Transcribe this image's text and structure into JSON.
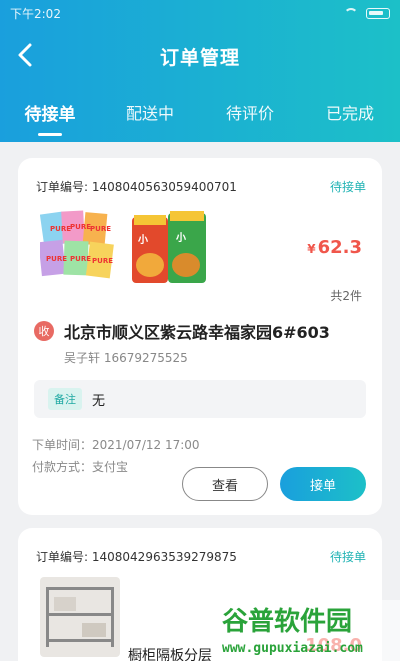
{
  "status_bar": {
    "time": "下午2:02"
  },
  "nav": {
    "title": "订单管理"
  },
  "tabs": [
    {
      "label": "待接单"
    },
    {
      "label": "配送中"
    },
    {
      "label": "待评价"
    },
    {
      "label": "已完成"
    }
  ],
  "orders": [
    {
      "order_no_label": "订单编号:",
      "order_no": "1408040563059400701",
      "status": "待接单",
      "currency": "¥",
      "price": "62.3",
      "qty": "共2件",
      "receiver_tag": "收",
      "address": "北京市顺义区紫云路幸福家园6#603",
      "contact": "吴子轩 16679275525",
      "remark_label": "备注",
      "remark": "无",
      "order_time": "下单时间：2021/07/12 17:00",
      "pay_method": "付款方式：支付宝",
      "view_label": "查看",
      "accept_label": "接单"
    },
    {
      "order_no_label": "订单编号:",
      "order_no": "1408042963539279875",
      "status": "待接单",
      "goods_name": "橱柜隔板分层",
      "price": "108.0"
    }
  ],
  "watermark": {
    "brand": "谷普软件园",
    "url": "www.gupuxiazai.com"
  },
  "colors": {
    "accent_start": "#1a9fdd",
    "accent_end": "#1cc0c8",
    "price": "#f0564b",
    "status": "#21b3b4"
  }
}
